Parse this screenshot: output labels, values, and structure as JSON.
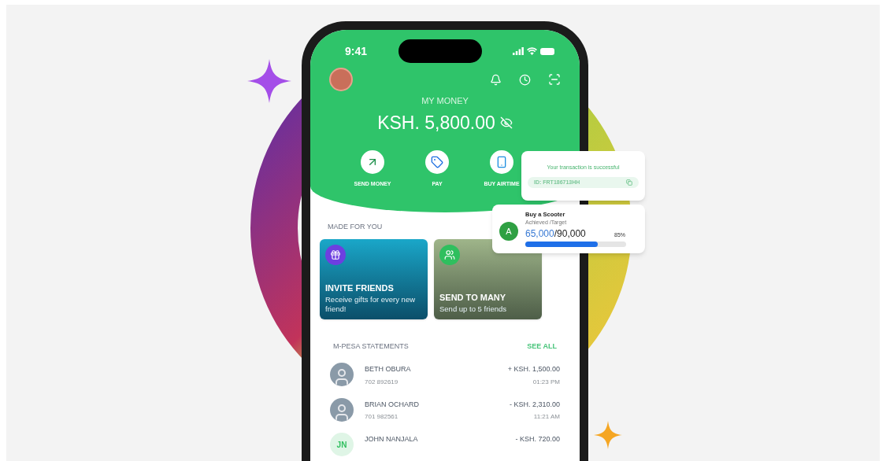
{
  "status_bar": {
    "time": "9:41"
  },
  "header": {
    "balance_label": "MY MONEY",
    "balance": "KSH. 5,800.00"
  },
  "actions": [
    {
      "kind": "send",
      "label": "SEND MONEY"
    },
    {
      "kind": "pay",
      "label": "PAY"
    },
    {
      "kind": "airtime",
      "label": "BUY AIRTIME"
    }
  ],
  "made_for_you": {
    "title": "MADE FOR YOU",
    "cards": [
      {
        "kind": "invite",
        "title": "INVITE FRIENDS",
        "subtitle": "Receive gifts for every new friend!",
        "color": "#6d3fe0"
      },
      {
        "kind": "group",
        "title": "SEND TO MANY",
        "subtitle": "Send up to 5 friends",
        "color": "#2fbf5e"
      }
    ]
  },
  "statements": {
    "title": "M-PESA STATEMENTS",
    "see_all": "SEE ALL",
    "rows": [
      {
        "kind": "photo",
        "name": "BETH OBURA",
        "phone": "702 892619",
        "amount": "+ KSH. 1,500.00",
        "time": "01:23 PM"
      },
      {
        "kind": "photo",
        "name": "BRIAN OCHARD",
        "phone": "701 982561",
        "amount": "- KSH. 2,310.00",
        "time": "11:21 AM"
      },
      {
        "kind": "initials",
        "initials": "JN",
        "name": "JOHN NANJALA",
        "amount": "- KSH. 720.00"
      }
    ]
  },
  "transaction_card": {
    "message": "Your transaction is successful",
    "id": "ID: FRT186713HH"
  },
  "goal_card": {
    "badge": "A",
    "title": "Buy a Scooter",
    "subtitle": "Achieved /Target",
    "achieved": "65,000",
    "target": "/90,000",
    "percent": "85%",
    "level": 0.72
  }
}
